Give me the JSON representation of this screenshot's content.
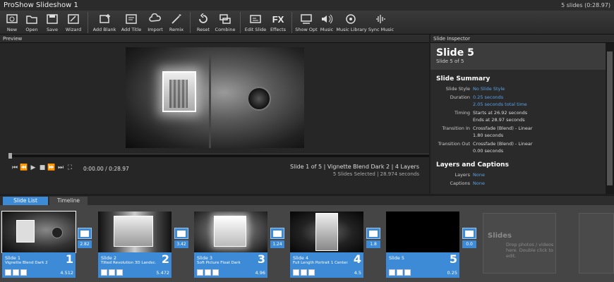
{
  "window": {
    "title": "ProShow Slideshow 1",
    "status": "5 slides (0:28.97)"
  },
  "toolbar": {
    "items": [
      {
        "label": "New"
      },
      {
        "label": "Open"
      },
      {
        "label": "Save"
      },
      {
        "label": "Wizard"
      },
      {
        "label": "Add Blank"
      },
      {
        "label": "Add Title"
      },
      {
        "label": "Import"
      },
      {
        "label": "Remix"
      },
      {
        "label": "Reset"
      },
      {
        "label": "Combine"
      },
      {
        "label": "Edit Slide"
      },
      {
        "label": "Effects"
      },
      {
        "label": "Show Opt"
      },
      {
        "label": "Music"
      },
      {
        "label": "Music Library"
      },
      {
        "label": "Sync Music"
      }
    ],
    "fx_glyph": "FX"
  },
  "preview": {
    "header": "Preview",
    "timecode": "0:00.00 / 0:28.97",
    "slide_line": "Slide 1 of 5  |  Vignette Blend Dark 2  |  4 Layers",
    "selection_line": "5 Slides Selected  |  28.974 seconds"
  },
  "inspector": {
    "header": "Slide Inspector",
    "title": "Slide 5",
    "subtitle": "Slide 5 of 5",
    "summary_title": "Slide Summary",
    "slide_style_label": "Slide Style",
    "slide_style_value": "No Slide Style",
    "duration_label": "Duration",
    "duration_value": "0.25 seconds",
    "duration_total": "2.05 seconds total time",
    "timing_label": "Timing",
    "timing_start": "Starts at 26.92 seconds",
    "timing_end": "Ends at 28.97 seconds",
    "trans_in_label": "Transition In",
    "trans_in_value": "Crossfade (Blend) - Linear",
    "trans_in_dur": "1.80 seconds",
    "trans_out_label": "Transition Out",
    "trans_out_value": "Crossfade (Blend) - Linear",
    "trans_out_dur": "0.00 seconds",
    "layers_title": "Layers and Captions",
    "layers_label": "Layers",
    "layers_value": "None",
    "captions_label": "Captions",
    "captions_value": "None"
  },
  "tabs": {
    "slide_list": "Slide List",
    "timeline": "Timeline"
  },
  "slides": [
    {
      "name": "Slide 1",
      "style": "Vignette Blend Dark 2",
      "duration": "4.512",
      "number": "1",
      "transition": "2.82"
    },
    {
      "name": "Slide 2",
      "style": "Tilted Revolution 3D Landsc...",
      "duration": "5.472",
      "number": "2",
      "transition": "3.42"
    },
    {
      "name": "Slide 3",
      "style": "Soft Picture Float Dark",
      "duration": "4.96",
      "number": "3",
      "transition": "1.24"
    },
    {
      "name": "Slide 4",
      "style": "Full Length Portrait 1 Center...",
      "duration": "4.5",
      "number": "4",
      "transition": "1.8"
    },
    {
      "name": "Slide 5",
      "style": "",
      "duration": "0.25",
      "number": "5",
      "transition": "0.0"
    }
  ],
  "dropzone": {
    "heading": "Slides",
    "hint": "Drop photos / videos here. Double click to edit."
  },
  "colors": {
    "accent": "#3d8bd6",
    "link": "#5aa0e6"
  }
}
